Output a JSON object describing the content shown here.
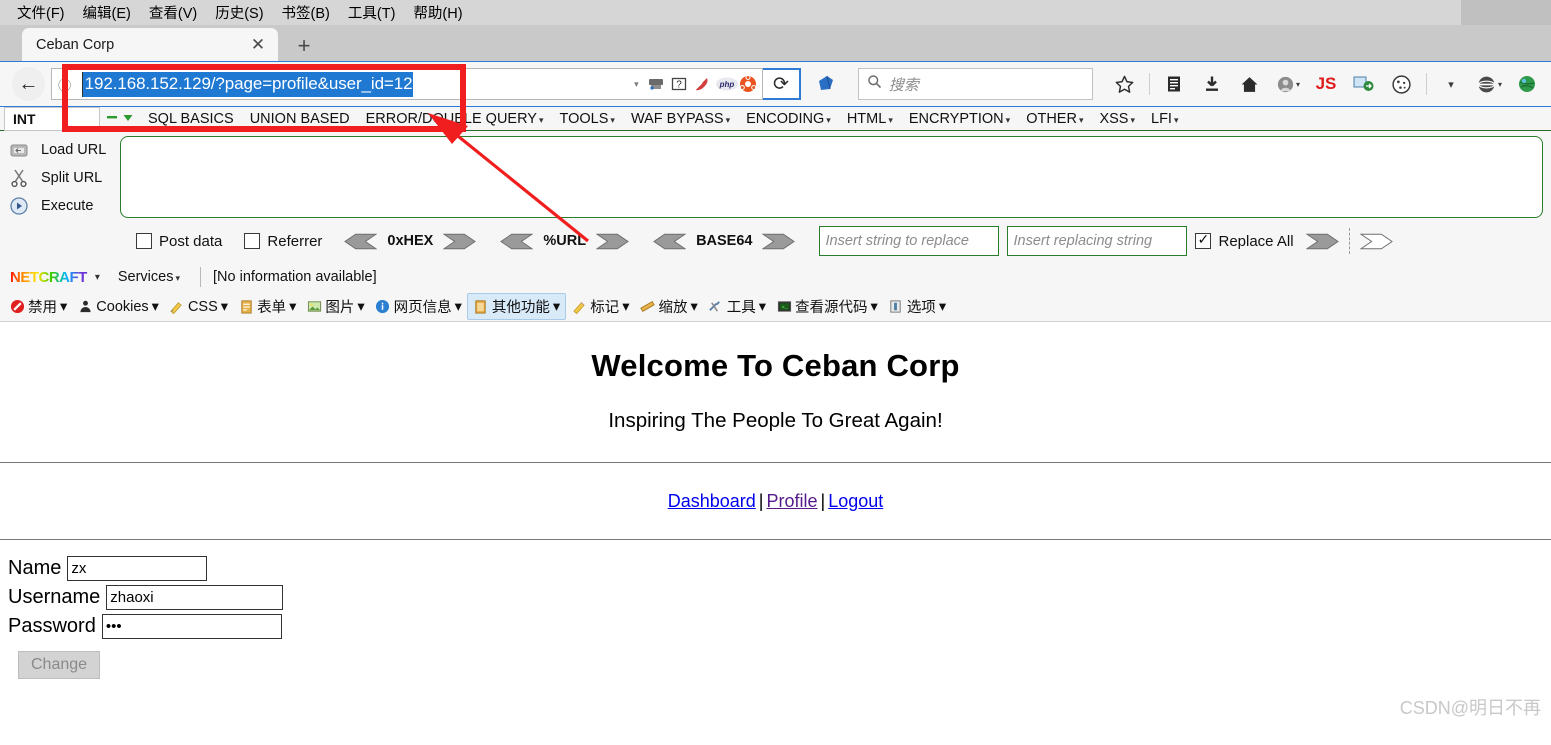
{
  "browser": {
    "menubar": [
      {
        "label": "文件(F)"
      },
      {
        "label": "编辑(E)"
      },
      {
        "label": "查看(V)"
      },
      {
        "label": "历史(S)"
      },
      {
        "label": "书签(B)"
      },
      {
        "label": "工具(T)"
      },
      {
        "label": "帮助(H)"
      }
    ],
    "tab": {
      "title": "Ceban Corp",
      "close_label": "✕",
      "newtab_label": "+"
    },
    "nav": {
      "back_label": "←",
      "identity_label": "ⓘ",
      "url_value": "192.168.152.129/?page=profile&user_id=12",
      "url_selected": true,
      "reload_label": "⟳",
      "dropdown_caret": "▾"
    },
    "search": {
      "placeholder": "搜索",
      "icon": "search-icon"
    },
    "toolbar_icons": [
      {
        "name": "bookmark-star-icon",
        "glyph": "☆"
      },
      {
        "name": "library-icon",
        "glyph": "▤"
      },
      {
        "name": "downloads-icon",
        "glyph": "⬇"
      },
      {
        "name": "home-icon",
        "glyph": "⌂"
      },
      {
        "name": "account-icon",
        "glyph": "●"
      },
      {
        "name": "javascript-toggle-icon",
        "glyph": "JS"
      },
      {
        "name": "proxy-switch-icon",
        "glyph": "▣"
      },
      {
        "name": "cookie-manager-icon",
        "glyph": "◍"
      },
      {
        "name": "user-agent-switcher-icon",
        "glyph": "⬓"
      },
      {
        "name": "globe-icon",
        "glyph": "◉"
      }
    ]
  },
  "bookmarks": {
    "int_label": "INT",
    "items": [
      {
        "label": "SQL BASICS",
        "caret": false
      },
      {
        "label": "UNION BASED",
        "caret": false
      },
      {
        "label": "ERROR/DOUBLE QUERY",
        "caret": true
      },
      {
        "label": "TOOLS",
        "caret": true
      },
      {
        "label": "WAF BYPASS",
        "caret": true
      },
      {
        "label": "ENCODING",
        "caret": true
      },
      {
        "label": "HTML",
        "caret": true
      },
      {
        "label": "ENCRYPTION",
        "caret": true
      },
      {
        "label": "OTHER",
        "caret": true
      },
      {
        "label": "XSS",
        "caret": true
      },
      {
        "label": "LFI",
        "caret": true
      }
    ]
  },
  "hackbar": {
    "actions": [
      {
        "label": "Load URL",
        "icon": "load-url-icon"
      },
      {
        "label": "Split URL",
        "icon": "split-url-icon"
      },
      {
        "label": "Execute",
        "icon": "execute-icon"
      }
    ],
    "textarea_value": "",
    "post_data": {
      "label": "Post data",
      "checked": false
    },
    "referrer": {
      "label": "Referrer",
      "checked": false
    },
    "encoders": [
      {
        "label": "0xHEX"
      },
      {
        "label": "%URL"
      },
      {
        "label": "BASE64"
      }
    ],
    "replace_from_placeholder": "Insert string to replace",
    "replace_to_placeholder": "Insert replacing string",
    "replace_all": {
      "label": "Replace All",
      "checked": true
    }
  },
  "netcraft": {
    "logo_text": "NETCRAFT",
    "caret": "▾",
    "services_label": "Services",
    "info_text": "[No information available]"
  },
  "webdev": {
    "items": [
      {
        "label": "禁用",
        "icon": "disable-icon",
        "active": false
      },
      {
        "label": "Cookies",
        "icon": "cookies-icon",
        "active": false
      },
      {
        "label": "CSS",
        "icon": "css-icon",
        "active": false
      },
      {
        "label": "表单",
        "icon": "forms-icon",
        "active": false
      },
      {
        "label": "图片",
        "icon": "images-icon",
        "active": false
      },
      {
        "label": "网页信息",
        "icon": "page-info-icon",
        "active": false
      },
      {
        "label": "其他功能",
        "icon": "misc-icon",
        "active": true
      },
      {
        "label": "标记",
        "icon": "outline-icon",
        "active": false
      },
      {
        "label": "缩放",
        "icon": "resize-icon",
        "active": false
      },
      {
        "label": "工具",
        "icon": "tools-icon",
        "active": false
      },
      {
        "label": "查看源代码",
        "icon": "view-source-icon",
        "active": false
      },
      {
        "label": "选项",
        "icon": "options-icon",
        "active": false
      }
    ]
  },
  "page": {
    "heading": "Welcome To Ceban Corp",
    "subheading": "Inspiring The People To Great Again!",
    "nav": {
      "dashboard": "Dashboard",
      "profile": "Profile",
      "logout": "Logout",
      "separator": "|"
    },
    "form": {
      "fields": [
        {
          "label": "Name",
          "value": "zx",
          "width": 140
        },
        {
          "label": "Username",
          "value": "zhaoxi",
          "width": 177
        },
        {
          "label": "Password",
          "value": "•••",
          "width": 180
        }
      ],
      "submit_label": "Change"
    }
  },
  "watermark": "CSDN@明日不再",
  "colors": {
    "annotation_red": "#f01e1e",
    "url_highlight": "#1f78d1",
    "link_blue": "#0000ee",
    "link_visited": "#551a8b",
    "hackbar_green": "#2a7d2a"
  }
}
